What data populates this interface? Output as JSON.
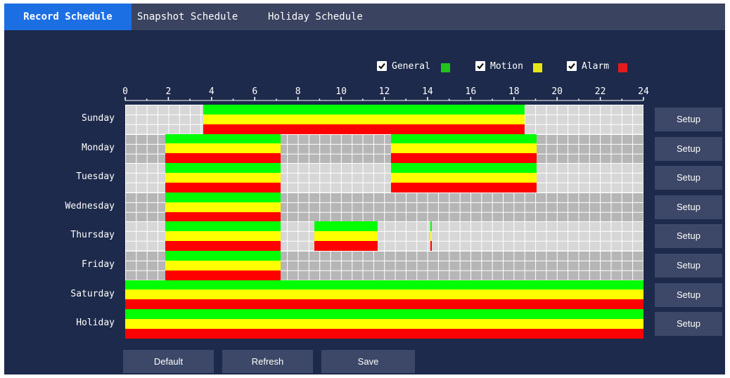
{
  "tabs": [
    {
      "label": "Record Schedule",
      "active": true
    },
    {
      "label": "Snapshot Schedule",
      "active": false
    },
    {
      "label": "Holiday Schedule",
      "active": false
    }
  ],
  "legend": [
    {
      "label": "General",
      "checked": true,
      "color": "#22c41a"
    },
    {
      "label": "Motion",
      "checked": true,
      "color": "#e6e616"
    },
    {
      "label": "Alarm",
      "checked": true,
      "color": "#e31b1b"
    }
  ],
  "colors": {
    "row_light": "#d7d7d7",
    "row_dark": "#b6b6b6",
    "grid_line": "#ffffff",
    "general": "#00ff00",
    "motion": "#ffff00",
    "alarm": "#ff0000",
    "background": "#1d2a4b",
    "tab_active": "#1b6fe3"
  },
  "axis": {
    "hours_max": 24,
    "tick_labels": [
      "0",
      "2",
      "4",
      "6",
      "8",
      "10",
      "12",
      "14",
      "16",
      "18",
      "20",
      "22",
      "24"
    ]
  },
  "schedule": [
    {
      "day": "Sunday",
      "periods": [
        [
          3.6,
          18.5
        ]
      ]
    },
    {
      "day": "Monday",
      "periods": [
        [
          1.85,
          7.2
        ],
        [
          12.3,
          19.05
        ]
      ]
    },
    {
      "day": "Tuesday",
      "periods": [
        [
          1.85,
          7.2
        ],
        [
          12.3,
          19.05
        ]
      ]
    },
    {
      "day": "Wednesday",
      "periods": [
        [
          1.85,
          7.2
        ]
      ]
    },
    {
      "day": "Thursday",
      "periods": [
        [
          1.85,
          7.2
        ],
        [
          8.75,
          11.7
        ],
        [
          14.12,
          14.2
        ]
      ]
    },
    {
      "day": "Friday",
      "periods": [
        [
          1.85,
          7.2
        ]
      ]
    },
    {
      "day": "Saturday",
      "periods": [
        [
          0,
          24
        ]
      ]
    },
    {
      "day": "Holiday",
      "periods": [
        [
          0,
          24
        ]
      ]
    }
  ],
  "row_setup_label": "Setup",
  "buttons": {
    "default": "Default",
    "refresh": "Refresh",
    "save": "Save"
  }
}
